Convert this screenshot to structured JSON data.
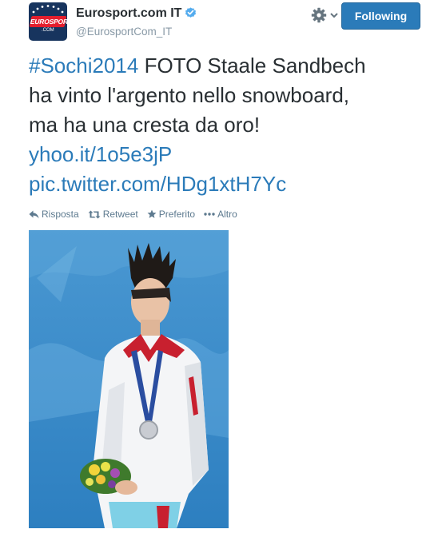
{
  "account": {
    "name": "Eurosport.com IT",
    "handle": "@EurosportCom_IT",
    "avatar_logo": "EUROSPORT",
    "avatar_suffix": ".COM"
  },
  "follow_button": "Following",
  "tweet": {
    "hashtag": "#Sochi2014",
    "text_1": " FOTO Staale Sandbech",
    "text_2": "ha vinto l'argento nello snowboard,",
    "text_3": "ma ha una cresta da oro!",
    "link": "yhoo.it/1o5e3jP",
    "pic_link": "pic.twitter.com/HDg1xtH7Yc"
  },
  "actions": [
    {
      "label": "Risposta",
      "icon": "reply-icon"
    },
    {
      "label": "Retweet",
      "icon": "retweet-icon"
    },
    {
      "label": "Preferito",
      "icon": "star-icon"
    },
    {
      "label": "Altro",
      "icon": "more-icon"
    }
  ],
  "colors": {
    "link": "#2b7bb9",
    "button": "#2b7bb9",
    "muted": "#8899a6",
    "verified": "#55acee"
  }
}
